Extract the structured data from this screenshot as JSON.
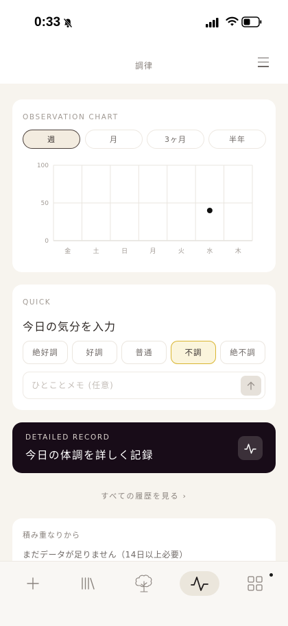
{
  "status_bar": {
    "time": "0:33"
  },
  "header": {
    "title": "調律"
  },
  "observation": {
    "label": "OBSERVATION CHART",
    "periods": [
      {
        "label": "週",
        "active": true
      },
      {
        "label": "月",
        "active": false
      },
      {
        "label": "3ヶ月",
        "active": false
      },
      {
        "label": "半年",
        "active": false
      }
    ]
  },
  "chart_data": {
    "type": "scatter",
    "categories": [
      "金",
      "土",
      "日",
      "月",
      "火",
      "水",
      "木"
    ],
    "y_ticks": [
      100,
      50,
      0
    ],
    "ylim": [
      0,
      100
    ],
    "points": [
      {
        "x": "水",
        "y": 40
      }
    ],
    "grid": true
  },
  "quick": {
    "label": "QUICK",
    "title": "今日の気分を入力",
    "moods": [
      {
        "label": "絶好調",
        "active": false
      },
      {
        "label": "好調",
        "active": false
      },
      {
        "label": "普通",
        "active": false
      },
      {
        "label": "不調",
        "active": true
      },
      {
        "label": "絶不調",
        "active": false
      }
    ],
    "memo_placeholder": "ひとことメモ (任意)"
  },
  "record": {
    "label": "DETAILED RECORD",
    "title": "今日の体調を詳しく記録"
  },
  "history_link": "すべての履歴を見る ›",
  "stack": {
    "label": "積み重なりから",
    "message": "まだデータが足りません（14日以上必要）"
  },
  "tabs": [
    {
      "icon": "plus-icon",
      "active": false
    },
    {
      "icon": "library-icon",
      "active": false
    },
    {
      "icon": "tree-icon",
      "active": false
    },
    {
      "icon": "pulse-icon",
      "active": true
    },
    {
      "icon": "grid-icon",
      "active": false,
      "badge": true
    }
  ],
  "colors": {
    "accent_dark": "#180c18",
    "mood_active": "#d9b530",
    "background": "#f7f4ee"
  }
}
